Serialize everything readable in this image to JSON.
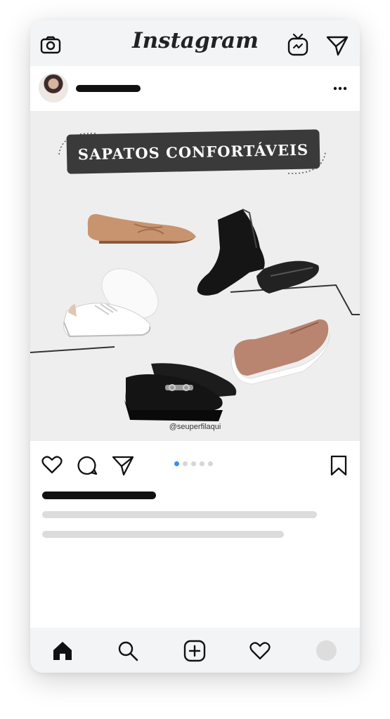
{
  "app": {
    "title": "Instagram"
  },
  "topbar": {
    "icons": [
      "camera-icon",
      "igtv-icon",
      "direct-message-icon"
    ]
  },
  "post": {
    "banner_title": "SAPATOS CONFORTÁVEIS",
    "handle": "@seuperfilaqui",
    "carousel": {
      "total": 5,
      "active": 1
    }
  },
  "actions": {
    "icons": [
      "heart-icon",
      "comment-icon",
      "share-icon",
      "bookmark-icon"
    ]
  },
  "bottom_nav": {
    "icons": [
      "home-icon",
      "search-icon",
      "add-post-icon",
      "activity-heart-icon",
      "profile-avatar"
    ]
  },
  "colors": {
    "accent_blue": "#3b8ff0",
    "banner_bg": "#3a3a3a",
    "image_bg": "#eeeeee"
  }
}
